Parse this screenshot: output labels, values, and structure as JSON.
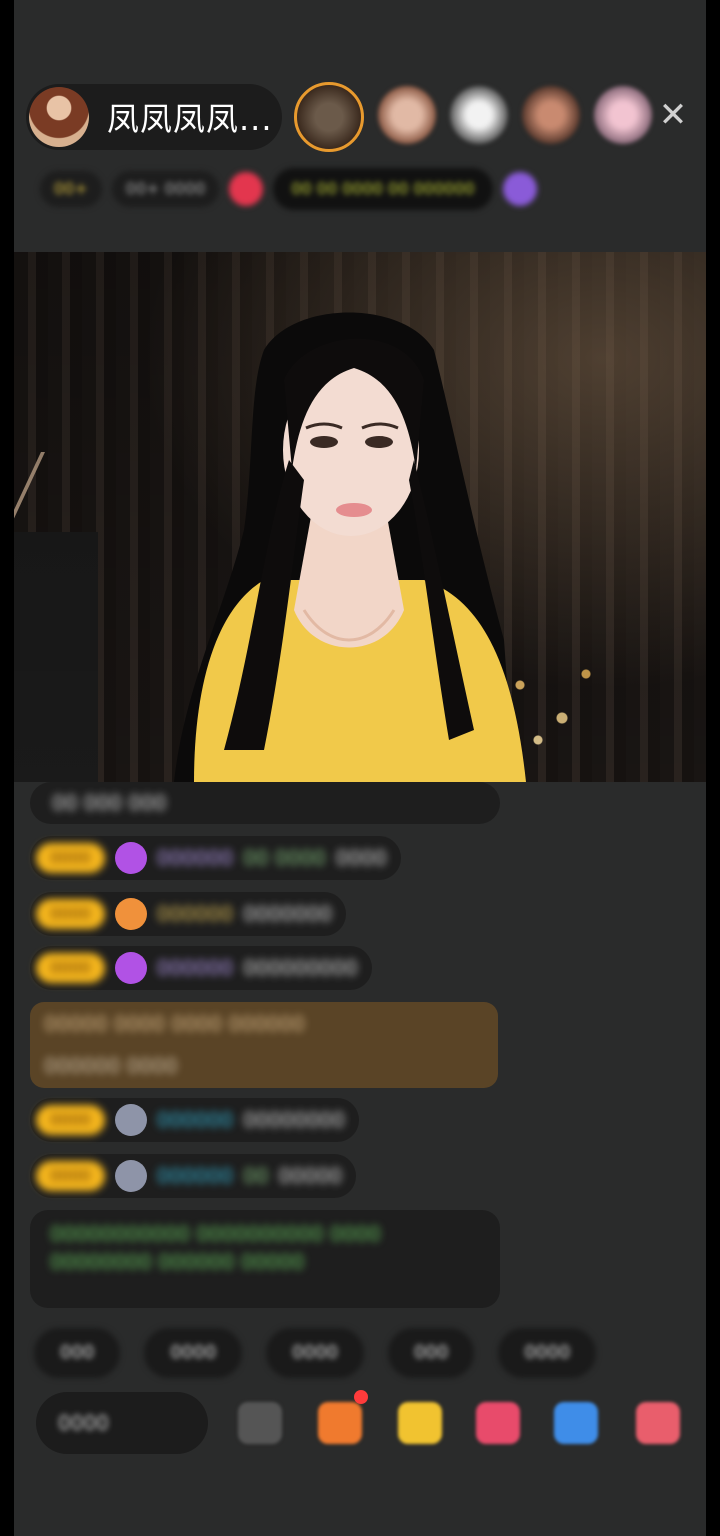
{
  "host": {
    "name": "凤凤凤凤..."
  },
  "viewers": [
    "viewer-1",
    "viewer-2",
    "viewer-3",
    "viewer-4",
    "viewer-5"
  ],
  "top_stats": [
    {
      "text": "00+"
    },
    {
      "text": "00+ 0000"
    },
    {
      "text": "00 00 0000 00 000000"
    }
  ],
  "close_icon": "close-icon",
  "chat": {
    "top_line": "00 000 000",
    "messages": [
      {
        "badge": "0000",
        "icon": "purple-gem-icon",
        "user": "000000",
        "level": "00 0000",
        "text": "0000"
      },
      {
        "badge": "0000",
        "icon": "orange-gem-icon",
        "user": "000000",
        "level": "",
        "text": "0000000"
      },
      {
        "badge": "0000",
        "icon": "purple-gem-icon",
        "user": "000000",
        "level": "",
        "text": "000000000"
      },
      {
        "badge": "0000",
        "icon": "grey-gem-icon",
        "user": "000000",
        "level": "",
        "text": "00000000"
      },
      {
        "badge": "0000",
        "icon": "grey-gem-icon",
        "user": "000000",
        "level": "00",
        "text": "00000"
      }
    ],
    "highlight": {
      "line1": "00000 0000 0000 000000",
      "line2": "000000 0000"
    },
    "system": "00000000000 0000000000 0000 00000000 000000 00000"
  },
  "quick_replies": [
    "000",
    "0000",
    "0000",
    "000",
    "0000"
  ],
  "toolbar": {
    "say_placeholder": "0000",
    "tools": [
      "more-icon",
      "gift-icon",
      "treasure-icon",
      "heart-icon",
      "game-icon",
      "shop-icon"
    ]
  }
}
